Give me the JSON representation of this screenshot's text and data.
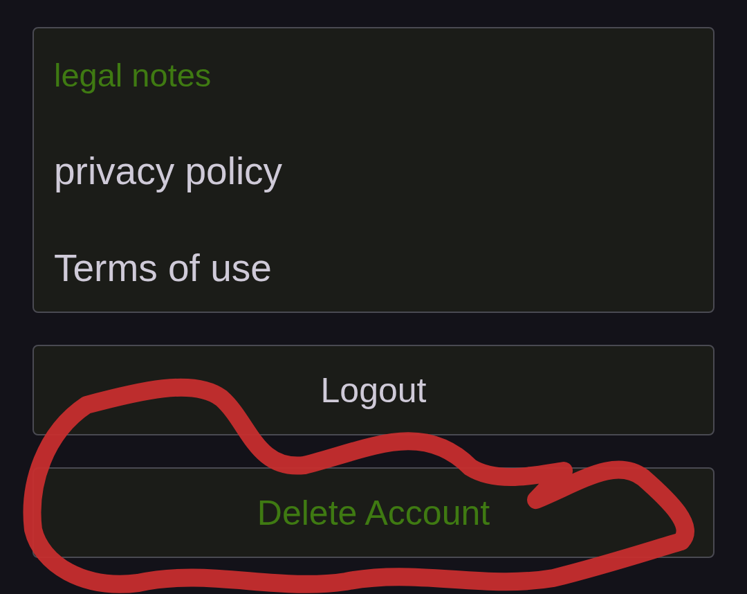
{
  "section": {
    "title": "legal notes",
    "items": [
      {
        "label": "privacy policy"
      },
      {
        "label": "Terms of use"
      }
    ]
  },
  "buttons": [
    {
      "label": "Logout",
      "kind": "plain"
    },
    {
      "label": "Delete Account",
      "kind": "accent"
    }
  ],
  "annotation": {
    "kind": "scribble"
  }
}
